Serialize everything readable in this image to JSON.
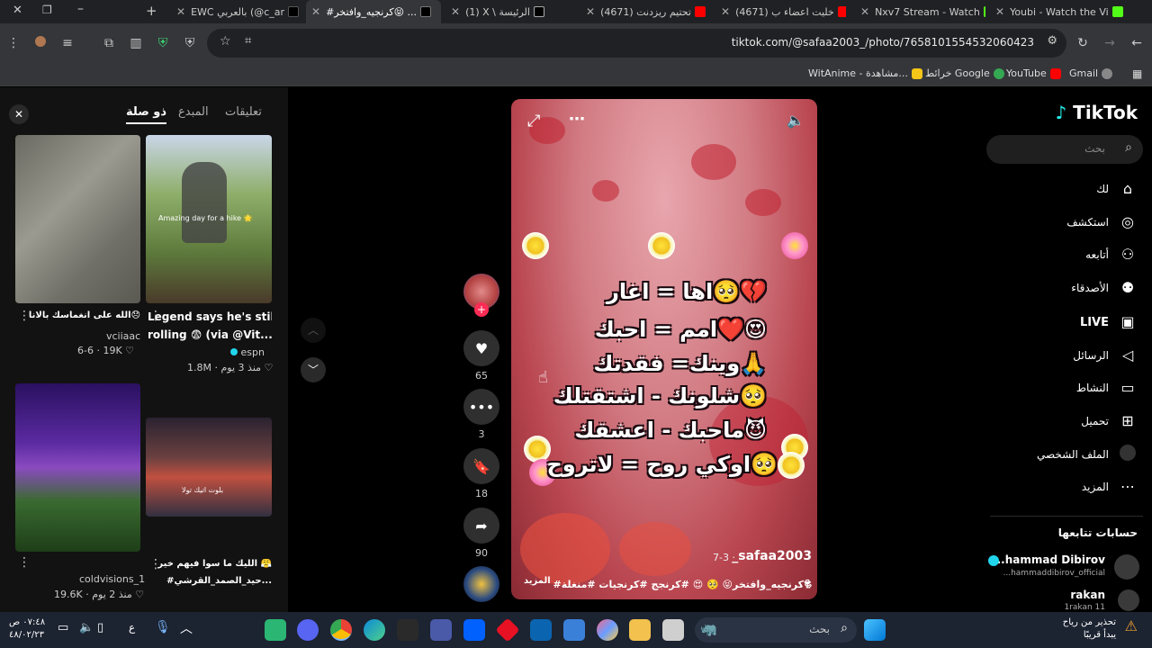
{
  "browser": {
    "tabs": [
      {
        "label": "Youbi - Watch the Vi",
        "color": "#53fc18"
      },
      {
        "label": "Nxv7 Stream - Watch",
        "color": "#53fc18"
      },
      {
        "label": "(4671) خليت اعضاء ب",
        "color": "#ff0000"
      },
      {
        "label": "(4671) تحتيم ريزدنت",
        "color": "#ff0000"
      },
      {
        "label": "(1) X \\ الرئيسة",
        "color": "#ffffff"
      },
      {
        "label": "#كرنجيه_وافتخر😝 ...",
        "color": "#000000"
      },
      {
        "label": "EWC بالعربي (@c_ar",
        "color": "#000000"
      }
    ],
    "url": "tiktok.com/@safaa2003_/photo/7658101554532060423",
    "bookmarks": [
      "Gmail",
      "YouTube",
      "خرائط Google",
      "WitAnime - مشاهدة..."
    ]
  },
  "left_panel": {
    "tabs": [
      "تعليقات",
      "المبدع",
      "ذو صلة"
    ],
    "active_tab": "ذو صلة",
    "videos": [
      {
        "caption": "Legend says he's still",
        "caption2": "rolling 😨 (via @Vit...",
        "author": "espn",
        "meta": "1.8M · منذ 3 يوم",
        "thumb_text": "Amazing day for a hike 🌟"
      },
      {
        "caption": "الله على انغماسك بالانا😞",
        "author": "vciiaac",
        "meta": "6-6 · 19K"
      },
      {
        "caption": "الليك ما سوا فيهم خير 😤",
        "caption2": "#حيد_الصمد_القرشي...",
        "author": "",
        "meta": "",
        "thumb_text": "بلوت اتيك تولا"
      },
      {
        "caption": "",
        "author": "coldvisions_1",
        "meta": "19.6K · منذ 2 يوم"
      }
    ]
  },
  "post": {
    "lines": [
      "اها = اغار🥺💔",
      "امم = احبك❤️😍",
      "وينك= فقدتك🙏",
      "شلونك - اشتقتلك🥺",
      "ماحبك - اعشقك😈",
      "اوكي روح = لاتروح🥺"
    ],
    "author": "_safaa2003",
    "date": "7-3 ·",
    "hashtags": "#كرنجيه_وافتخر😝 🥺 😍 #كرنجج #كرنجيات #منغلة🕏",
    "more": "المزيد"
  },
  "actions": {
    "likes": "65",
    "comments": "3",
    "saves": "18",
    "shares": "90"
  },
  "sidebar": {
    "logo": "TikTok",
    "search_placeholder": "بحث",
    "nav": [
      "لك",
      "استكشف",
      "أتابعه",
      "الأصدقاء",
      "LIVE",
      "الرسائل",
      "النشاط",
      "تحميل",
      "الملف الشخصي",
      "المزيد"
    ],
    "following_title": "حسابات تتابعها",
    "following": [
      {
        "name": "...hammad Dibirov",
        "handle": "...hammaddibirov_official"
      },
      {
        "name": "rakan",
        "handle": "1rakan 11"
      }
    ]
  },
  "taskbar": {
    "search_placeholder": "بحث",
    "time": "٠٧:٤٨ ص",
    "date": "٤٨/٠٢/٢٣",
    "weather": "تحذير من رياح",
    "weather_sub": "يبدأ قريبًا",
    "lang": "ع"
  }
}
